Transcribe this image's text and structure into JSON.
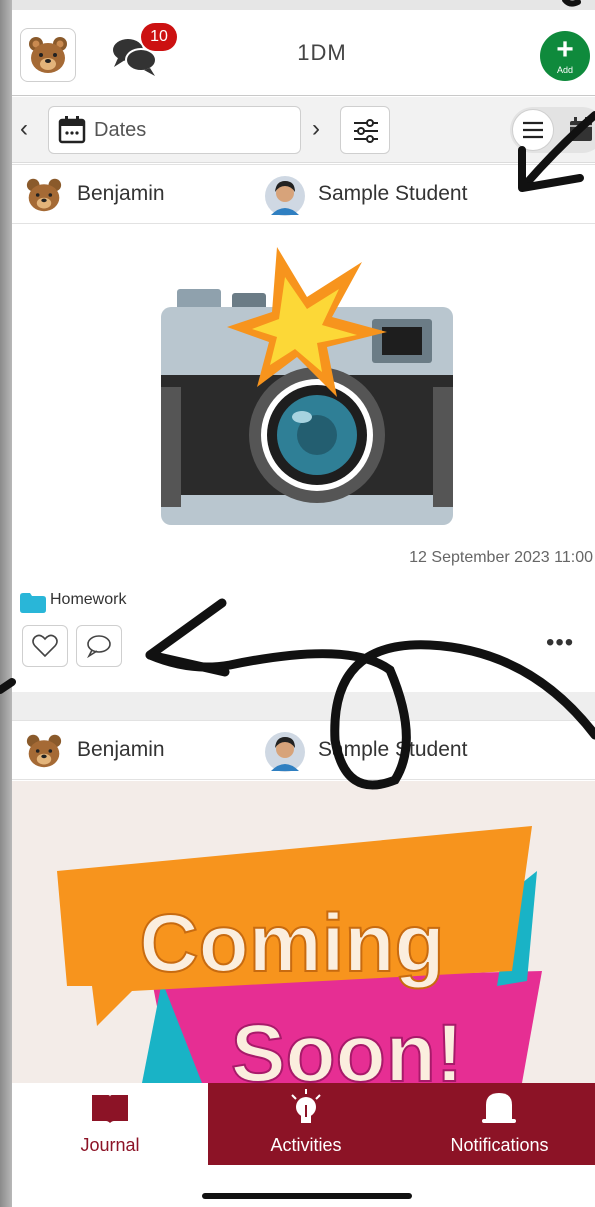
{
  "header": {
    "title": "1DM",
    "chat_badge": "10",
    "add_label": "Add"
  },
  "toolbar": {
    "dates_label": "Dates"
  },
  "posts": [
    {
      "teacher": "Benjamin",
      "student": "Sample Student",
      "timestamp": "12 September 2023 11:00",
      "folder": "Homework"
    },
    {
      "teacher": "Benjamin",
      "student": "Sample Student",
      "image_text_line1": "Coming",
      "image_text_line2": "Soon!"
    }
  ],
  "bottom_nav": {
    "items": [
      {
        "label": "Journal",
        "icon": "book-icon"
      },
      {
        "label": "Activities",
        "icon": "lightbulb-icon"
      },
      {
        "label": "Notifications",
        "icon": "bell-icon"
      }
    ]
  },
  "colors": {
    "brand": "#8c1326",
    "add_green": "#0f8a3c",
    "badge_red": "#cc1111"
  }
}
